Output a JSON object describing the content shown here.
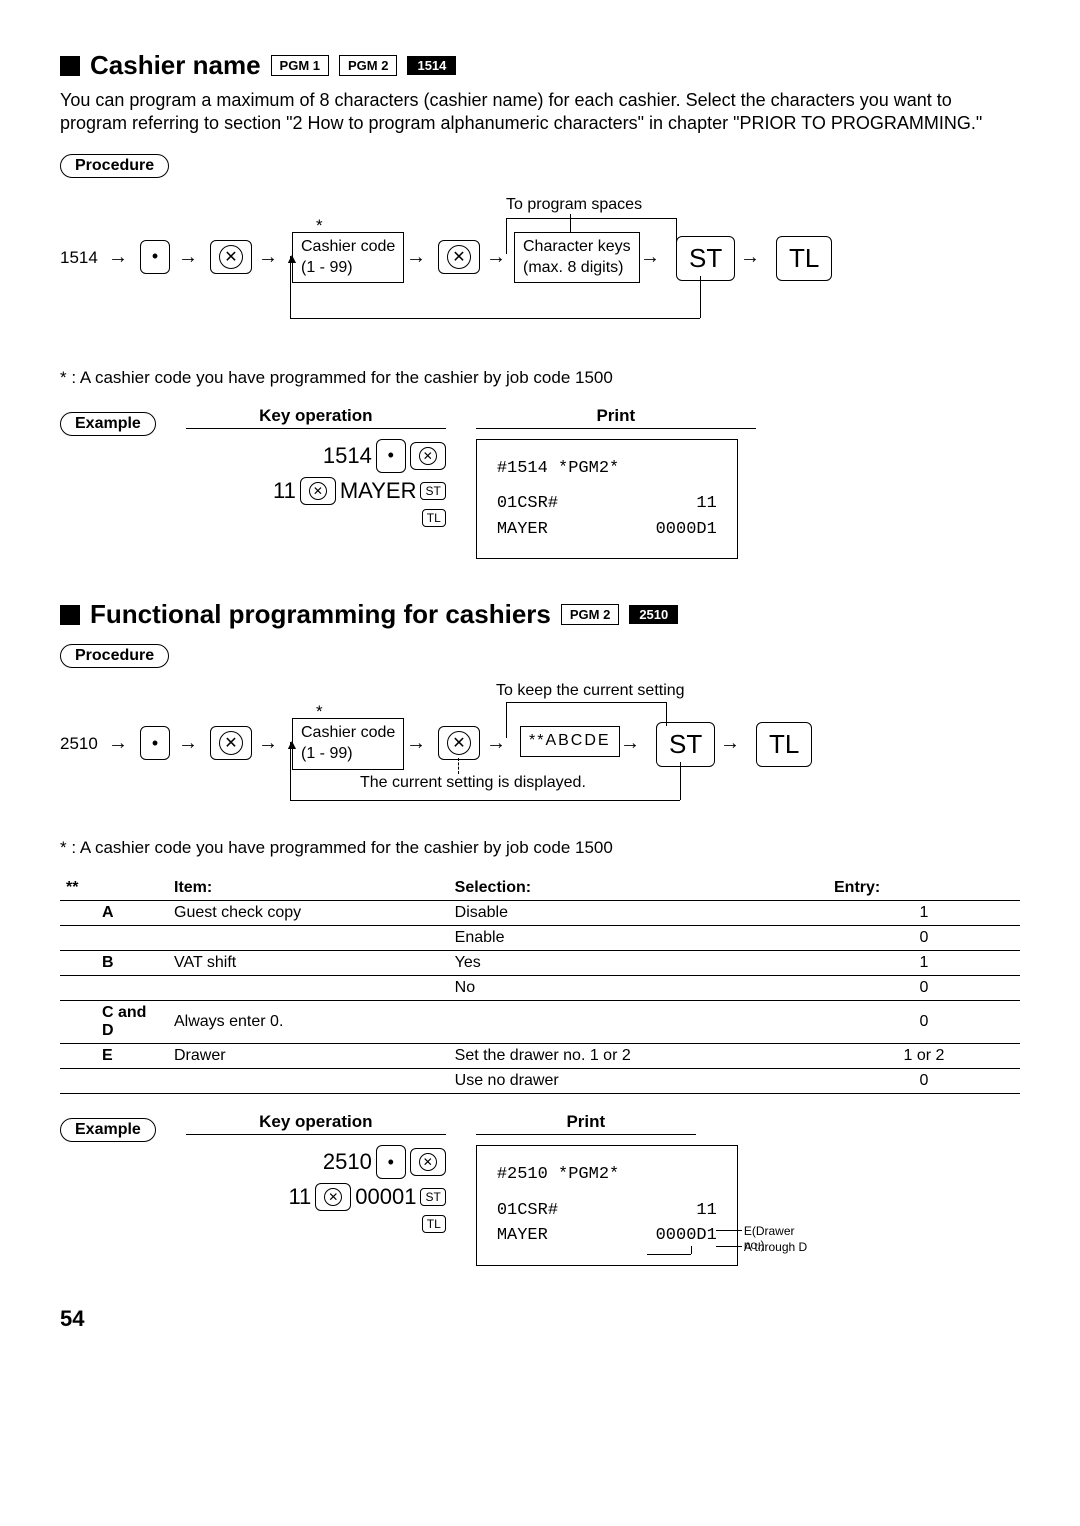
{
  "section1": {
    "title": "Cashier name",
    "badges": [
      "PGM 1",
      "PGM 2"
    ],
    "badge_inverse": "1514",
    "para": "You can program a maximum of 8 characters (cashier name) for each cashier. Select the characters you want to program referring to section \"2 How to program alphanumeric characters\" in chapter \"PRIOR TO PROGRAMMING.\"",
    "procedure_label": "Procedure",
    "diagram": {
      "code": "1514",
      "star": "*",
      "box1_l1": "Cashier code",
      "box1_l2": "(1 - 99)",
      "note_top": "To program spaces",
      "box2_l1": "Character keys",
      "box2_l2": "(max. 8 digits)",
      "st": "ST",
      "tl": "TL"
    },
    "footnote": "* : A cashier code you have programmed for the cashier by job code 1500",
    "example_label": "Example",
    "keyop_head": "Key operation",
    "print_head": "Print",
    "keyop": {
      "l1_num": "1514",
      "l2_num": "11",
      "l2_name": "MAYER"
    },
    "print": {
      "l1": "#1514 *PGM2*",
      "l2a": "01CSR#",
      "l2b": "11",
      "l3a": "MAYER",
      "l3b": "0000D1"
    }
  },
  "section2": {
    "title": "Functional programming for cashiers",
    "badges": [
      "PGM 2"
    ],
    "badge_inverse": "2510",
    "procedure_label": "Procedure",
    "diagram": {
      "code": "2510",
      "star": "*",
      "box1_l1": "Cashier code",
      "box1_l2": "(1 - 99)",
      "note_top": "To keep the current setting",
      "abcde": "**ABCDE",
      "note_below": "The current setting is displayed.",
      "st": "ST",
      "tl": "TL"
    },
    "footnote": "* : A cashier code you have programmed for the cashier by job code 1500",
    "table_head": {
      "item": "Item:",
      "sel": "Selection:",
      "entry": "Entry:",
      "star": "**"
    },
    "rows": [
      {
        "k": "A",
        "item": "Guest check copy",
        "sel": "Disable",
        "entry": "1"
      },
      {
        "k": "",
        "item": "",
        "sel": "Enable",
        "entry": "0"
      },
      {
        "k": "B",
        "item": "VAT shift",
        "sel": "Yes",
        "entry": "1"
      },
      {
        "k": "",
        "item": "",
        "sel": "No",
        "entry": "0"
      },
      {
        "k": "C and D",
        "item": "Always enter 0.",
        "sel": "",
        "entry": "0"
      },
      {
        "k": "E",
        "item": "Drawer",
        "sel": "Set the drawer no. 1 or 2",
        "entry": "1 or 2"
      },
      {
        "k": "",
        "item": "",
        "sel": "Use no drawer",
        "entry": "0"
      }
    ],
    "example_label": "Example",
    "keyop_head": "Key operation",
    "print_head": "Print",
    "keyop": {
      "l1_num": "2510",
      "l2_num": "11",
      "l2_val": "00001"
    },
    "print": {
      "l1": "#2510 *PGM2*",
      "l2a": "01CSR#",
      "l2b": "11",
      "l3a": "MAYER",
      "l3b": "0000D1",
      "ann1": "E(Drawer no.)",
      "ann2": "A through D"
    }
  },
  "labels": {
    "st": "ST",
    "tl": "TL"
  },
  "page_number": "54"
}
